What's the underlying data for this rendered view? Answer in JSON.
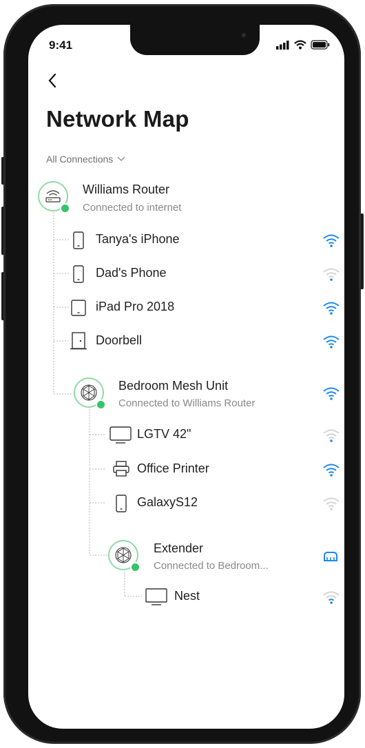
{
  "status_bar": {
    "time": "9:41",
    "icons": [
      "signal-icon",
      "wifi-icon",
      "battery-icon"
    ]
  },
  "header": {
    "back_icon": "chevron-left-icon",
    "title": "Network Map"
  },
  "filter": {
    "label": "All Connections",
    "icon": "chevron-down-icon"
  },
  "colors": {
    "accent": "#1e88f0",
    "hub_ring": "#8fd9a8",
    "online_dot": "#35c46a",
    "weak_signal": "#cfcfcf"
  },
  "router": {
    "name": "Williams Router",
    "status": "Connected to internet",
    "icon": "router-icon"
  },
  "router_devices": [
    {
      "name": "Tanya's iPhone",
      "icon": "phone-icon",
      "signal": 3
    },
    {
      "name": "Dad's Phone",
      "icon": "phone-icon",
      "signal": 1
    },
    {
      "name": "iPad Pro 2018",
      "icon": "tablet-icon",
      "signal": 3
    },
    {
      "name": "Doorbell",
      "icon": "doorbell-icon",
      "signal": 3
    }
  ],
  "mesh": {
    "name": "Bedroom Mesh Unit",
    "status": "Connected to Williams Router",
    "icon": "mesh-node-icon",
    "signal": 3
  },
  "mesh_devices": [
    {
      "name": "LGTV 42\"",
      "icon": "tv-icon",
      "signal": 1
    },
    {
      "name": "Office Printer",
      "icon": "printer-icon",
      "signal": 3
    },
    {
      "name": "GalaxyS12",
      "icon": "phone-icon",
      "signal": 0
    }
  ],
  "extender": {
    "name": "Extender",
    "status": "Connected to Bedroom...",
    "icon": "mesh-node-icon",
    "link_icon": "ethernet-icon"
  },
  "extender_devices": [
    {
      "name": "Nest",
      "icon": "monitor-icon",
      "signal": 1
    }
  ]
}
